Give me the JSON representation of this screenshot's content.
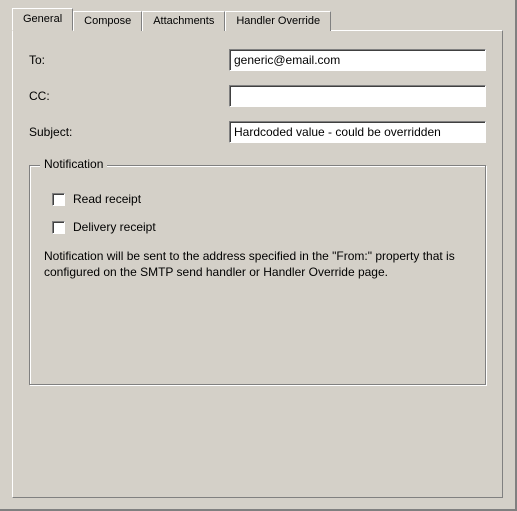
{
  "tabs": {
    "general": "General",
    "compose": "Compose",
    "attachments": "Attachments",
    "handler_override": "Handler Override"
  },
  "form": {
    "to_label": "To:",
    "to_value": "generic@email.com",
    "cc_label": "CC:",
    "cc_value": "",
    "subject_label": "Subject:",
    "subject_value": "Hardcoded value - could be overridden"
  },
  "notification": {
    "legend": "Notification",
    "read_receipt_label": "Read receipt",
    "read_receipt_checked": false,
    "delivery_receipt_label": "Delivery receipt",
    "delivery_receipt_checked": false,
    "description": "Notification will be sent to the address specified in the \"From:\" property that is configured on the SMTP send handler or Handler Override page."
  }
}
